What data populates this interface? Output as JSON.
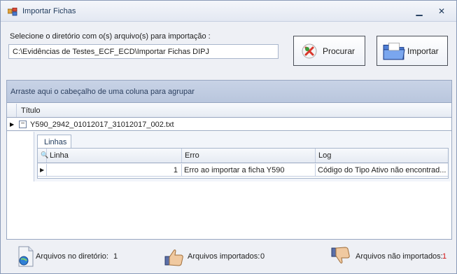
{
  "window": {
    "title": "Importar Fichas",
    "minimize_icon": "minimize-icon",
    "close_icon": "close-icon"
  },
  "directory": {
    "label": "Selecione o diretório com o(s) arquivo(s) para importação :",
    "path": "C:\\Evidências de Testes_ECF_ECD\\Importar Fichas DIPJ"
  },
  "buttons": {
    "browse_label": "Procurar",
    "import_label": "Importar"
  },
  "grid": {
    "group_panel_text": "Arraste aqui o cabeçalho de uma coluna para agrupar",
    "column_header": "Título",
    "rows": [
      {
        "title": "Y590_2942_01012017_31012017_002.txt",
        "detail_tab": "Linhas",
        "detail_columns": [
          "Linha",
          "Erro",
          "Log"
        ],
        "detail_rows": [
          {
            "linha": "1",
            "erro": "Erro ao importar a ficha Y590",
            "log": "Código do Tipo Ativo não encontrad..."
          }
        ]
      }
    ]
  },
  "status": {
    "dir_label": "Arquivos no diretório:",
    "dir_count": "1",
    "imported_label": "Arquivos importados:",
    "imported_count": "0",
    "not_imported_label": "Arquivos não importados:",
    "not_imported_count": "1",
    "not_imported_color": "#d01010"
  }
}
